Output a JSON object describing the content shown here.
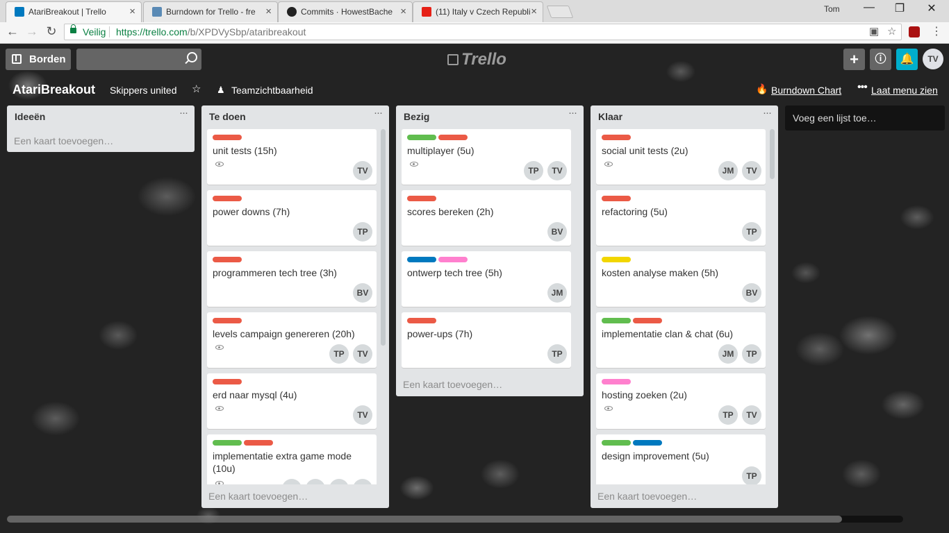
{
  "browser": {
    "tabs": [
      {
        "title": "AtariBreakout | Trello",
        "favicon_color": "#0079bf"
      },
      {
        "title": "Burndown for Trello - fre",
        "favicon_color": "#5a8ab5"
      },
      {
        "title": "Commits · HowestBache",
        "favicon_color": "#222222"
      },
      {
        "title": "(11) Italy v Czech Republi",
        "favicon_color": "#e62117"
      }
    ],
    "user": "Tom",
    "secure_label": "Veilig",
    "url_host": "https://trello.com",
    "url_path": "/b/XPDVySbp/ataribreakout"
  },
  "trello": {
    "boards_label": "Borden",
    "logo": "Trello",
    "avatar": "TV",
    "board_name": "AtariBreakout",
    "team": "Skippers united",
    "visibility": "Teamzichtbaarheid",
    "burndown": "Burndown Chart",
    "menu": "Laat menu zien",
    "add_list": "Voeg een lijst toe…",
    "lists": [
      {
        "title": "Ideeën",
        "add_card": "Een kaart toevoegen…",
        "cards": []
      },
      {
        "title": "Te doen",
        "add_card": "Een kaart toevoegen…",
        "cards": [
          {
            "title": "unit tests (15h)",
            "labels": [
              "#eb5a46"
            ],
            "watch": true,
            "members": [
              "TV"
            ]
          },
          {
            "title": "power downs (7h)",
            "labels": [
              "#eb5a46"
            ],
            "watch": false,
            "members": [
              "TP"
            ]
          },
          {
            "title": "programmeren tech tree (3h)",
            "labels": [
              "#eb5a46"
            ],
            "watch": false,
            "members": [
              "BV"
            ]
          },
          {
            "title": "levels campaign genereren (20h)",
            "labels": [
              "#eb5a46"
            ],
            "watch": true,
            "members": [
              "TP",
              "TV"
            ]
          },
          {
            "title": "erd naar mysql (4u)",
            "labels": [
              "#eb5a46"
            ],
            "watch": true,
            "members": [
              "TV"
            ]
          },
          {
            "title": "implementatie extra game mode (10u)",
            "labels": [
              "#61bd4f",
              "#eb5a46"
            ],
            "watch": true,
            "members": [
              "",
              "",
              "",
              ""
            ]
          }
        ]
      },
      {
        "title": "Bezig",
        "add_card": "Een kaart toevoegen…",
        "cards": [
          {
            "title": "multiplayer (5u)",
            "labels": [
              "#61bd4f",
              "#eb5a46"
            ],
            "watch": true,
            "members": [
              "TP",
              "TV"
            ]
          },
          {
            "title": "scores bereken (2h)",
            "labels": [
              "#eb5a46"
            ],
            "watch": false,
            "members": [
              "BV"
            ]
          },
          {
            "title": "ontwerp tech tree (5h)",
            "labels": [
              "#0079bf",
              "#ff80ce"
            ],
            "watch": false,
            "members": [
              "JM"
            ]
          },
          {
            "title": "power-ups (7h)",
            "labels": [
              "#eb5a46"
            ],
            "watch": false,
            "members": [
              "TP"
            ]
          }
        ]
      },
      {
        "title": "Klaar",
        "add_card": "Een kaart toevoegen…",
        "cards": [
          {
            "title": "social unit tests (2u)",
            "labels": [
              "#eb5a46"
            ],
            "watch": true,
            "members": [
              "JM",
              "TV"
            ]
          },
          {
            "title": "refactoring (5u)",
            "labels": [
              "#eb5a46"
            ],
            "watch": false,
            "members": [
              "TP"
            ]
          },
          {
            "title": "kosten analyse maken (5h)",
            "labels": [
              "#f2d600"
            ],
            "watch": false,
            "members": [
              "BV"
            ]
          },
          {
            "title": "implementatie clan & chat (6u)",
            "labels": [
              "#61bd4f",
              "#eb5a46"
            ],
            "watch": false,
            "members": [
              "JM",
              "TP"
            ]
          },
          {
            "title": "hosting zoeken (2u)",
            "labels": [
              "#ff80ce"
            ],
            "watch": true,
            "members": [
              "TP",
              "TV"
            ]
          },
          {
            "title": "design improvement (5u)",
            "labels": [
              "#61bd4f",
              "#0079bf"
            ],
            "watch": false,
            "members": [
              "TP"
            ]
          }
        ]
      }
    ]
  }
}
